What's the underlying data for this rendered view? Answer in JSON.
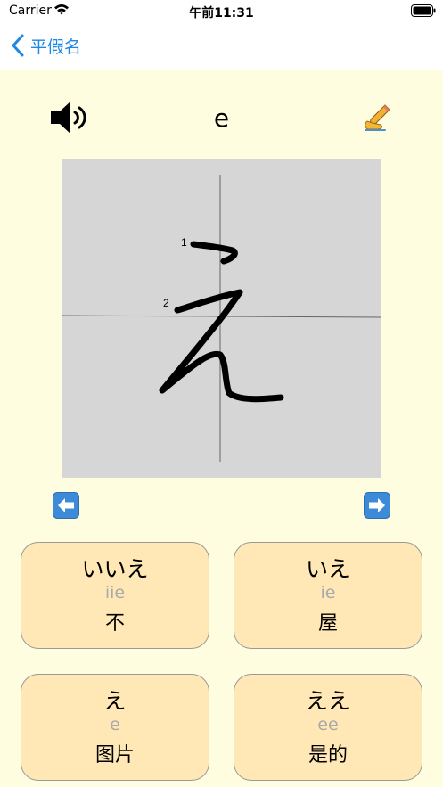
{
  "status_bar": {
    "carrier": "Carrier",
    "time": "午前11:31",
    "icons": [
      "wifi-icon",
      "battery-icon"
    ]
  },
  "nav": {
    "back_label": "平假名",
    "accent_color": "#1E88E5"
  },
  "character": {
    "romaji": "e",
    "kana": "え",
    "stroke_numbers": [
      "1",
      "2"
    ],
    "icons": [
      "speaker-icon",
      "writing-hand-icon"
    ]
  },
  "navigation_buttons": {
    "prev_icon": "left-arrow-icon",
    "next_icon": "right-arrow-icon",
    "button_color": "#3D8BD8"
  },
  "words": [
    {
      "kana": "いいえ",
      "romaji": "iie",
      "meaning": "不"
    },
    {
      "kana": "いえ",
      "romaji": "ie",
      "meaning": "屋"
    },
    {
      "kana": "え",
      "romaji": "e",
      "meaning": "图片"
    },
    {
      "kana": "ええ",
      "romaji": "ee",
      "meaning": "是的"
    }
  ],
  "colors": {
    "background": "#FFFDE0",
    "card_fill": "#FFE8B6",
    "canvas": "#D6D6D6",
    "romaji_gray": "#AAAAAA"
  }
}
